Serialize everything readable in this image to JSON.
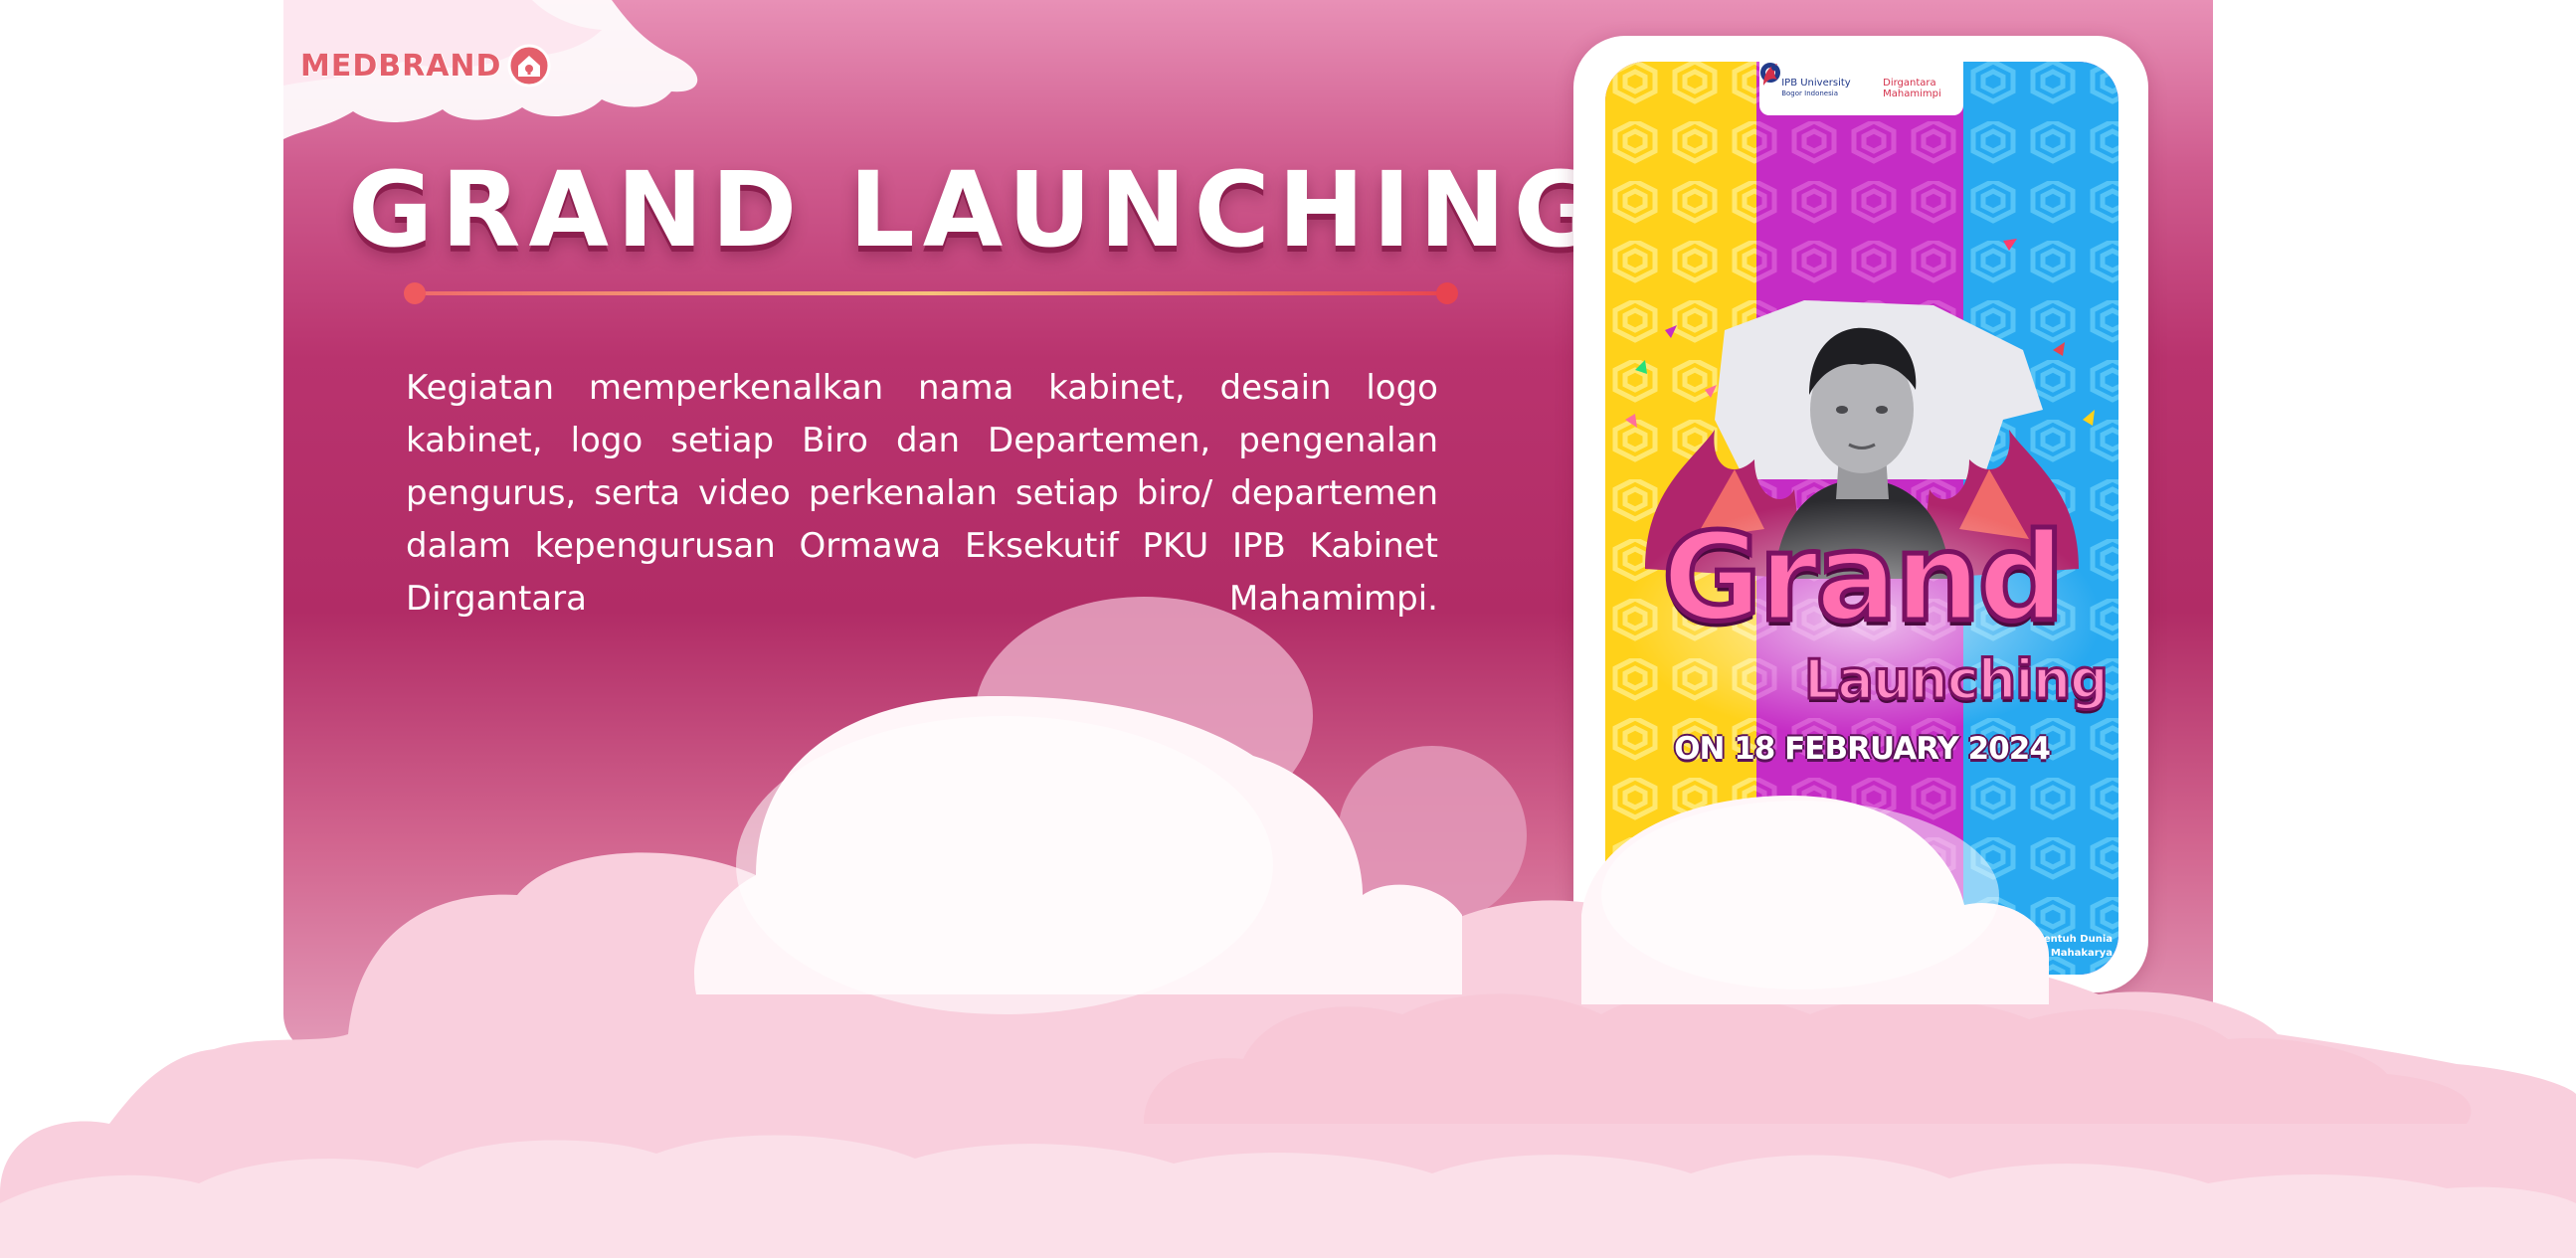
{
  "brand": {
    "name": "MEDBRAND",
    "logo_icon": "medbrand-house-icon"
  },
  "header": {
    "title": "GRAND LAUNCHING"
  },
  "main": {
    "description": "Kegiatan memperkenalkan nama kabinet, desain logo kabinet, logo setiap Biro dan Departemen, pengenalan pengurus, serta video perkenalan setiap biro/ departemen dalam kepengurusan Ormawa Eksekutif PKU IPB Kabinet Dirgantara Mahamimpi."
  },
  "poster": {
    "logo_ipb_line1": "IPB University",
    "logo_ipb_line2": "Bogor Indonesia",
    "logo_dirgantara_line1": "Dirgantara",
    "logo_dirgantara_line2": "Mahamimpi",
    "title_line1": "Grand",
    "title_line2": "Launching",
    "date": "ON 18 FEBRUARY 2024",
    "tagline_line1": "Sentuh Dunia",
    "tagline_line2": "dengan Mahakarya"
  },
  "colors": {
    "card_top": "#e890b6",
    "card_mid": "#b12c66",
    "card_bottom": "#e39ab8",
    "brand_red": "#e35f6b",
    "poster_yellow": "#ffd21a",
    "poster_magenta": "#c52cc5",
    "poster_cyan": "#27a9f0",
    "cloud_pink": "#fbd6e1",
    "cloud_white": "#fff5f8"
  }
}
